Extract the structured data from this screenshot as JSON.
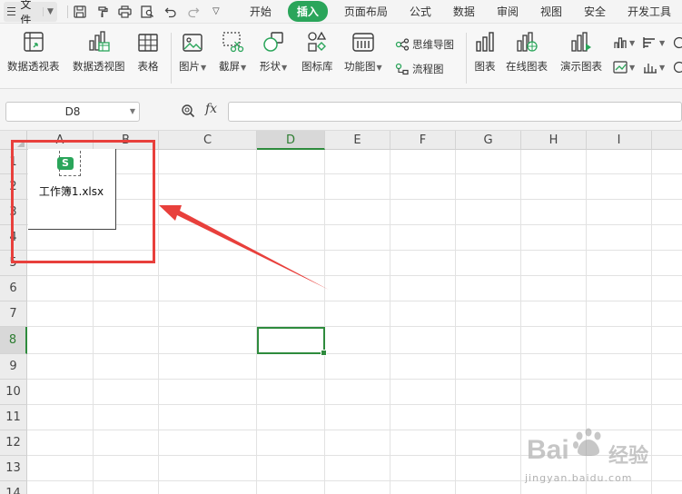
{
  "menubar": {
    "file_label": "文件",
    "quick_icons": [
      "save-icon",
      "format-painter-icon",
      "print-icon",
      "print-preview-icon",
      "undo-icon",
      "redo-icon",
      "more-icon"
    ],
    "tabs": [
      {
        "label": "开始",
        "active": false
      },
      {
        "label": "插入",
        "active": true
      },
      {
        "label": "页面布局",
        "active": false
      },
      {
        "label": "公式",
        "active": false
      },
      {
        "label": "数据",
        "active": false
      },
      {
        "label": "审阅",
        "active": false
      },
      {
        "label": "视图",
        "active": false
      },
      {
        "label": "安全",
        "active": false
      },
      {
        "label": "开发工具",
        "active": false
      }
    ],
    "active_color": "#2aa55a"
  },
  "ribbon": {
    "pivot_table": "数据透视表",
    "pivot_chart": "数据透视图",
    "table": "表格",
    "picture": "图片",
    "screenshot": "截屏",
    "shape": "形状",
    "icon_library": "图标库",
    "function_chart": "功能图",
    "mind_map": "思维导图",
    "flowchart": "流程图",
    "chart": "图表",
    "online_chart": "在线图表",
    "demo_chart": "演示图表"
  },
  "formula_bar": {
    "name_box": "D8",
    "fx_label": "fx",
    "formula": ""
  },
  "grid": {
    "columns": [
      "A",
      "B",
      "C",
      "D",
      "E",
      "F",
      "G",
      "H",
      "I"
    ],
    "rows": [
      "1",
      "2",
      "3",
      "4",
      "5",
      "6",
      "7",
      "8",
      "9",
      "10",
      "11",
      "12",
      "13",
      "14"
    ],
    "selected_column": "D",
    "selected_row": "8",
    "selection_color": "#2e8b3d"
  },
  "embedded_object": {
    "badge": "S",
    "filename": "工作簿1.xlsx"
  },
  "annotation": {
    "highlight_color": "#e8403c"
  },
  "watermark": {
    "brand": "Bai",
    "brand_suffix": "经验",
    "url": "jingyan.baidu.com"
  }
}
